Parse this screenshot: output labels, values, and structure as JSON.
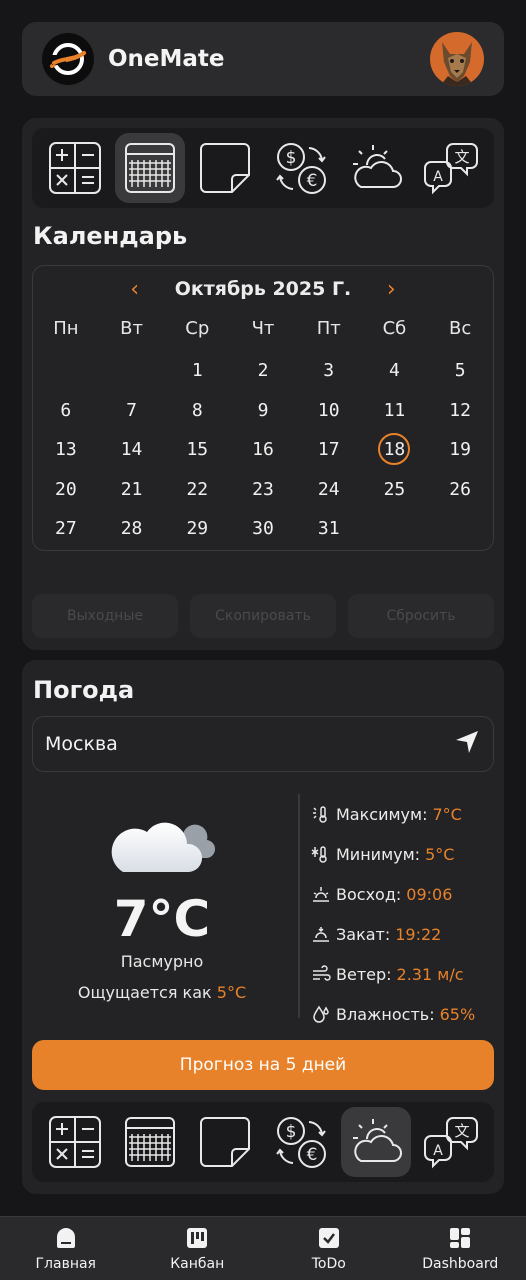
{
  "header": {
    "title": "OneMate"
  },
  "toolbar_icons": [
    "calculator-icon",
    "calendar-icon",
    "sticky-note-icon",
    "currency-exchange-icon",
    "weather-icon",
    "translate-icon"
  ],
  "calendar": {
    "section_title": "Календарь",
    "month_label": "Октябрь 2025 Г.",
    "weekdays": [
      "Пн",
      "Вт",
      "Ср",
      "Чт",
      "Пт",
      "Сб",
      "Вс"
    ],
    "weeks": [
      [
        "",
        "",
        "1",
        "2",
        "3",
        "4",
        "5"
      ],
      [
        "6",
        "7",
        "8",
        "9",
        "10",
        "11",
        "12"
      ],
      [
        "13",
        "14",
        "15",
        "16",
        "17",
        "18",
        "19"
      ],
      [
        "20",
        "21",
        "22",
        "23",
        "24",
        "25",
        "26"
      ],
      [
        "27",
        "28",
        "29",
        "30",
        "31",
        "",
        ""
      ]
    ],
    "today": "18",
    "actions": {
      "weekends": "Выходные",
      "copy": "Скопировать",
      "reset": "Сбросить"
    }
  },
  "weather": {
    "section_title": "Погода",
    "city": "Москва",
    "temperature": "7°C",
    "condition": "Пасмурно",
    "feels_label": "Ощущается как",
    "feels_value": "5°C",
    "stats": [
      {
        "label": "Максимум:",
        "value": "7°C",
        "icon": "thermometer-sun-icon"
      },
      {
        "label": "Минимум:",
        "value": "5°C",
        "icon": "thermometer-snow-icon"
      },
      {
        "label": "Восход:",
        "value": "09:06",
        "icon": "sunrise-icon"
      },
      {
        "label": "Закат:",
        "value": "19:22",
        "icon": "sunset-icon"
      },
      {
        "label": "Ветер:",
        "value": " 2.31 м/с",
        "icon": "wind-icon"
      },
      {
        "label": "Влажность:",
        "value": "65%",
        "icon": "humidity-icon"
      }
    ],
    "forecast_button": "Прогноз на 5 дней"
  },
  "nav": {
    "home": "Главная",
    "kanban": "Канбан",
    "todo": "ToDo",
    "dashboard": "Dashboard"
  },
  "colors": {
    "accent": "#e8822a",
    "background": "#161618",
    "card": "#232325"
  }
}
